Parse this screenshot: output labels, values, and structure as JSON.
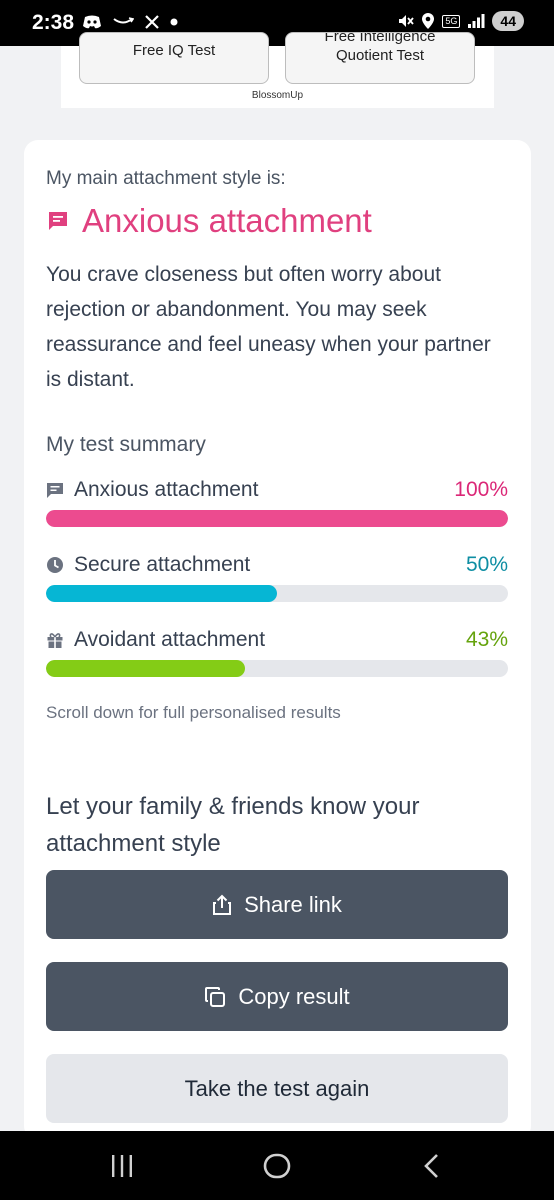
{
  "status_bar": {
    "time": "2:38",
    "network": "5G",
    "battery": "44"
  },
  "ad": {
    "button_1": "Free IQ Test",
    "button_2_line1": "Free Intelligence",
    "button_2_line2": "Quotient Test",
    "brand": "BlossomUp"
  },
  "result": {
    "label": "My main attachment style is:",
    "title": "Anxious attachment",
    "description": "You crave closeness but often worry about rejection or abandonment. You may seek reassurance and feel uneasy when your partner is distant."
  },
  "summary": {
    "label": "My test summary",
    "items": [
      {
        "name": "Anxious attachment",
        "percent_text": "100%",
        "value": 1.0,
        "color": "#ec4b8f",
        "text_color": "#db2777",
        "icon": "chat-icon"
      },
      {
        "name": "Secure attachment",
        "percent_text": "50%",
        "value": 0.5,
        "color": "#06b6d4",
        "text_color": "#0e8ea3",
        "icon": "clock-icon"
      },
      {
        "name": "Avoidant attachment",
        "percent_text": "43%",
        "value": 0.43,
        "color": "#84cc16",
        "text_color": "#65a30d",
        "icon": "gift-icon"
      }
    ],
    "note": "Scroll down for full personalised results"
  },
  "share": {
    "title": "Let your family & friends know your attachment style",
    "share_link": "Share link",
    "copy_result": "Copy result",
    "retake": "Take the test again"
  },
  "colors": {
    "accent": "#e0407f",
    "dark_button": "#4b5563",
    "light_button": "#e5e7eb"
  }
}
